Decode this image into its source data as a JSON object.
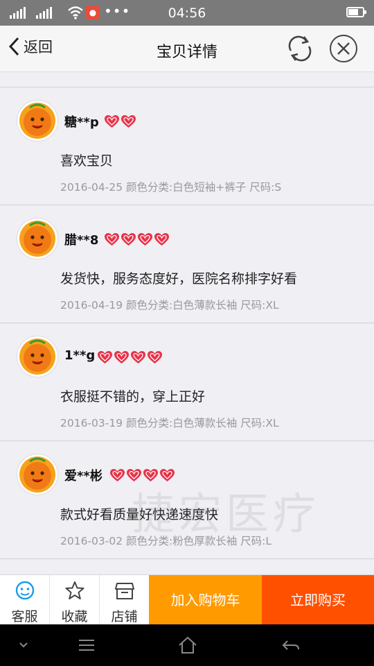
{
  "status_bar": {
    "time": "04:56",
    "notification_icon": "app-notification-icon"
  },
  "header": {
    "back_label": "返回",
    "title": "宝贝详情"
  },
  "reviews": [
    {
      "user": "糖**p",
      "hearts": 2,
      "comment": "喜欢宝贝",
      "meta": "2016-04-25 颜色分类:白色短袖+裤子 尺码:S"
    },
    {
      "user": "腊**8",
      "hearts": 4,
      "comment": "发货快，服务态度好，医院名称排字好看",
      "meta": "2016-04-19 颜色分类:白色薄款长袖 尺码:XL"
    },
    {
      "user": "1**g",
      "hearts": 4,
      "comment": "衣服挺不错的，穿上正好",
      "meta": "2016-03-19 颜色分类:白色薄款长袖 尺码:XL"
    },
    {
      "user": "爱**彬",
      "hearts": 4,
      "comment": "款式好看质量好快递速度快",
      "meta": "2016-03-02 颜色分类:粉色厚款长袖 尺码:L"
    }
  ],
  "watermark": "捷宏医疗",
  "bottom_bar": {
    "service_label": "客服",
    "favorite_label": "收藏",
    "shop_label": "店铺",
    "cart_label": "加入购物车",
    "buy_label": "立即购买"
  },
  "colors": {
    "cart": "#ff9a00",
    "buy": "#ff5000",
    "heart": "#e8334a",
    "service": "#1a9ce8"
  }
}
